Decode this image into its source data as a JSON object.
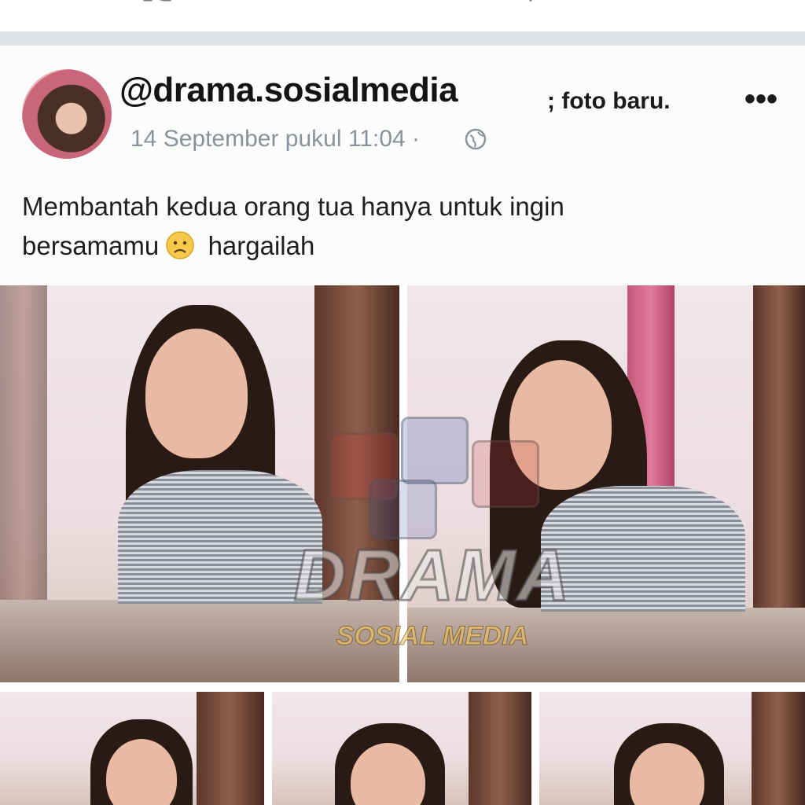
{
  "post": {
    "handle": "@drama.sosialmedia",
    "caption_tail": "; foto baru.",
    "timestamp": "14 September pukul 11:04 ·",
    "text_line1": "Membantah kedua orang tua hanya untuk ingin",
    "text_line2_before": "bersamamu",
    "text_line2_after": "hargailah"
  },
  "watermark": {
    "title": "DRAMA",
    "subtitle": "SOSIAL MEDIA"
  },
  "icons": {
    "like": "like-icon",
    "share": "share-icon",
    "globe": "globe-icon",
    "more": "more-icon",
    "emoji": "sad-face-emoji"
  },
  "colors": {
    "separator": "#dfe3e6",
    "timestamp": "#8d9199",
    "text": "#1c1e21"
  }
}
